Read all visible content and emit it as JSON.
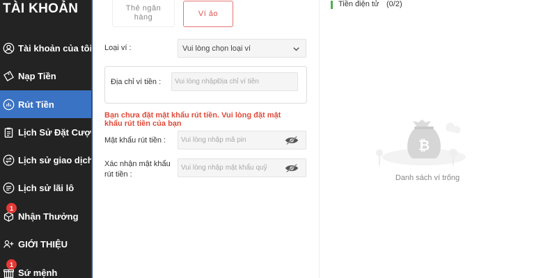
{
  "sidebar": {
    "title": "TÀI KHOẢN",
    "items": [
      {
        "label": "Tài khoản của tôi",
        "icon": "user-circle-icon"
      },
      {
        "label": "Nạp Tiền",
        "icon": "deposit-tag-icon"
      },
      {
        "label": "Rút Tiền",
        "icon": "withdraw-chart-icon",
        "active": true
      },
      {
        "label": "Lịch Sử Đặt Cược",
        "icon": "clipboard-icon"
      },
      {
        "label": "Lịch sử giao dịch",
        "icon": "transaction-swap-icon"
      },
      {
        "label": "Lịch sử lãi lô",
        "icon": "list-circle-icon"
      },
      {
        "label": "Nhận Thưởng",
        "icon": "gift-box-icon",
        "badge": "1"
      },
      {
        "label": "GIỚI THIỆU",
        "icon": "referral-users-icon"
      },
      {
        "label": "Sứ mệnh",
        "icon": "mission-gift-icon",
        "badge": "1"
      }
    ]
  },
  "tabs": [
    {
      "label": "Thẻ ngân hàng"
    },
    {
      "label": "Ví ảo",
      "active": true
    }
  ],
  "form": {
    "wallet_type_label": "Loại ví :",
    "wallet_type_value": "Vui lòng chọn loại ví",
    "address_label": "Địa chỉ ví tiền :",
    "address_placeholder": "Vui lòng nhậpĐịa chỉ ví tiền",
    "warning": "Bạn chưa đặt mật khẩu rút tiền. Vui lòng đặt mật khẩu rút tiền của bạn",
    "pin_label": "Mật khẩu rút tiền :",
    "pin_placeholder": "Vui lòng nhập mã pin",
    "confirm_label": "Xác nhận mật khẩu rút tiền :",
    "confirm_placeholder": "Vui lòng nhập mật khẩu quỹ"
  },
  "right_panel": {
    "crypto_label": "Tiền điện tử",
    "crypto_count": "(0/2)",
    "empty_text": "Danh sách ví trống",
    "empty_icon_text": "₿"
  },
  "colors": {
    "sidebar_bg": "#232323",
    "sidebar_active": "#3b73c4",
    "accent_red": "#e04b3a",
    "badge_red": "#e53935",
    "crypto_bar": "#4caf50"
  }
}
